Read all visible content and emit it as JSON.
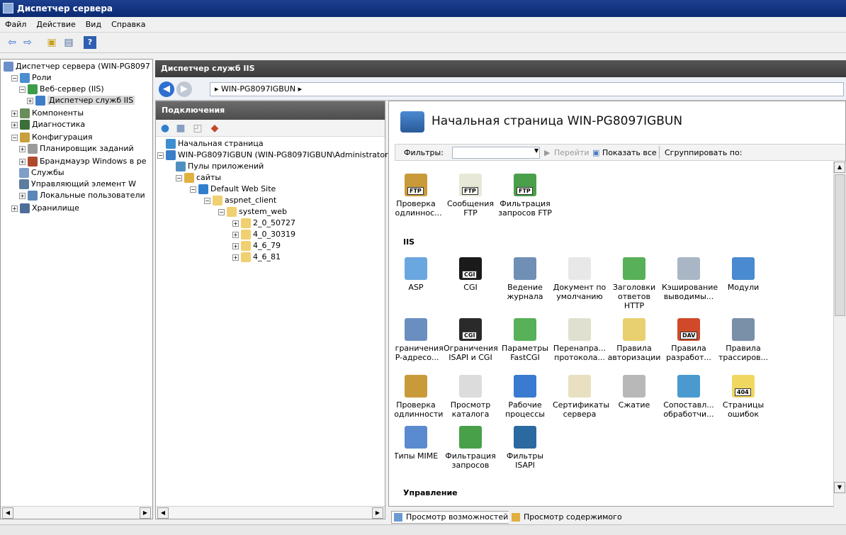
{
  "window": {
    "title": "Диспетчер сервера"
  },
  "menu": [
    "Файл",
    "Действие",
    "Вид",
    "Справка"
  ],
  "left_tree": [
    {
      "label": "Диспетчер сервера (WIN-PG8097",
      "level": 0,
      "exp": "",
      "color": "#6c8fc9"
    },
    {
      "label": "Роли",
      "level": 1,
      "exp": "−",
      "color": "#4d8ed3"
    },
    {
      "label": "Веб-сервер (IIS)",
      "level": 2,
      "exp": "−",
      "color": "#3d9b4a"
    },
    {
      "label": "Диспетчер служб IIS",
      "level": 3,
      "exp": "+",
      "color": "#3d7ec9",
      "selected": true
    },
    {
      "label": "Компоненты",
      "level": 1,
      "exp": "+",
      "color": "#6b8d5a"
    },
    {
      "label": "Диагностика",
      "level": 1,
      "exp": "+",
      "color": "#3c6f3c"
    },
    {
      "label": "Конфигурация",
      "level": 1,
      "exp": "−",
      "color": "#c9a03d"
    },
    {
      "label": "Планировщик заданий",
      "level": 2,
      "exp": "+",
      "color": "#9a9a9a"
    },
    {
      "label": "Брандмауэр Windows в ре",
      "level": 2,
      "exp": "+",
      "color": "#b04a2d"
    },
    {
      "label": "Службы",
      "level": 2,
      "exp": "",
      "color": "#7f9fc9"
    },
    {
      "label": "Управляющий элемент W",
      "level": 2,
      "exp": "",
      "color": "#5c7d9f"
    },
    {
      "label": "Локальные пользователи",
      "level": 2,
      "exp": "+",
      "color": "#5c86b8"
    },
    {
      "label": "Хранилище",
      "level": 1,
      "exp": "+",
      "color": "#4f6e97"
    }
  ],
  "iis_header": "Диспетчер служб IIS",
  "address": "▸  WIN-PG8097IGBUN  ▸",
  "connections": {
    "title": "Подключения",
    "tree": [
      {
        "label": "Начальная страница",
        "level": 0,
        "exp": "",
        "color": "#3d8ecf"
      },
      {
        "label": "WIN-PG8097IGBUN (WIN-PG8097IGBUN\\Administrator)",
        "level": 0,
        "exp": "−",
        "color": "#3a7ec9"
      },
      {
        "label": "Пулы приложений",
        "level": 1,
        "exp": "",
        "color": "#4f8fc0"
      },
      {
        "label": "сайты",
        "level": 1,
        "exp": "−",
        "color": "#e0b040"
      },
      {
        "label": "Default Web Site",
        "level": 2,
        "exp": "−",
        "color": "#2f7fcf"
      },
      {
        "label": "aspnet_client",
        "level": 3,
        "exp": "−",
        "color": "#f0d070"
      },
      {
        "label": "system_web",
        "level": 4,
        "exp": "−",
        "color": "#f0d070"
      },
      {
        "label": "2_0_50727",
        "level": 5,
        "exp": "+",
        "color": "#f0d070"
      },
      {
        "label": "4_0_30319",
        "level": 5,
        "exp": "+",
        "color": "#f0d070"
      },
      {
        "label": "4_6_79",
        "level": 5,
        "exp": "+",
        "color": "#f0d070"
      },
      {
        "label": "4_6_81",
        "level": 5,
        "exp": "+",
        "color": "#f0d070"
      }
    ]
  },
  "content": {
    "title": "Начальная страница WIN-PG8097IGBUN",
    "filter_label": "Фильтры:",
    "go_label": "Перейти",
    "show_all_label": "Показать все",
    "group_label": "Сгруппировать по:",
    "ftp_items": [
      {
        "label": "Проверка подлиннос...",
        "color": "#c89a3a",
        "mark": "FTP"
      },
      {
        "label": "Сообщения FTP",
        "color": "#e8e8d8",
        "mark": "FTP"
      },
      {
        "label": "Фильтрация запросов FTP",
        "color": "#4aa04a",
        "mark": "FTP"
      }
    ],
    "iis_section": "IIS",
    "iis_items": [
      {
        "label": "ASP",
        "color": "#6aa7e0",
        "mark": ""
      },
      {
        "label": "CGI",
        "color": "#1a1a1a",
        "mark": "CGI"
      },
      {
        "label": "Ведение журнала",
        "color": "#6f8fb5",
        "mark": ""
      },
      {
        "label": "Документ по умолчанию",
        "color": "#e8e8e8",
        "mark": ""
      },
      {
        "label": "Заголовки ответов HTTP",
        "color": "#58b058",
        "mark": ""
      },
      {
        "label": "Кэширование выводимы...",
        "color": "#a9b6c6",
        "mark": ""
      },
      {
        "label": "Модули",
        "color": "#4a8ad0",
        "mark": ""
      },
      {
        "label": "Ограничения IP-адресо...",
        "color": "#6a8ec0",
        "mark": ""
      },
      {
        "label": "Ограничения ISAPI и CGI",
        "color": "#2a2a2a",
        "mark": "CGI"
      },
      {
        "label": "Параметры FastCGI",
        "color": "#58b058",
        "mark": ""
      },
      {
        "label": "Перенапра... протокола...",
        "color": "#e0e0d0",
        "mark": ""
      },
      {
        "label": "Правила авторизации",
        "color": "#e8d070",
        "mark": ""
      },
      {
        "label": "Правила разработ...",
        "color": "#d04a2a",
        "mark": "DAV"
      },
      {
        "label": "Правила трассиров...",
        "color": "#7a8fa8",
        "mark": ""
      },
      {
        "label": "Проверка подлинности",
        "color": "#c89a3a",
        "mark": ""
      },
      {
        "label": "Просмотр каталога",
        "color": "#dcdcdc",
        "mark": ""
      },
      {
        "label": "Рабочие процессы",
        "color": "#3a7ad0",
        "mark": ""
      },
      {
        "label": "Сертификаты сервера",
        "color": "#e8e0c0",
        "mark": ""
      },
      {
        "label": "Сжатие",
        "color": "#b8b8b8",
        "mark": ""
      },
      {
        "label": "Сопоставл... обработчи...",
        "color": "#4a9ad0",
        "mark": ""
      },
      {
        "label": "Страницы ошибок",
        "color": "#f0d860",
        "mark": "404"
      },
      {
        "label": "Типы MIME",
        "color": "#5a8ad0",
        "mark": ""
      },
      {
        "label": "Фильтрация запросов",
        "color": "#48a048",
        "mark": ""
      },
      {
        "label": "Фильтры ISAPI",
        "color": "#2a6aa0",
        "mark": ""
      }
    ],
    "mgmt_section": "Управление"
  },
  "bottom_tabs": [
    "Просмотр возможностей",
    "Просмотр содержимого"
  ]
}
